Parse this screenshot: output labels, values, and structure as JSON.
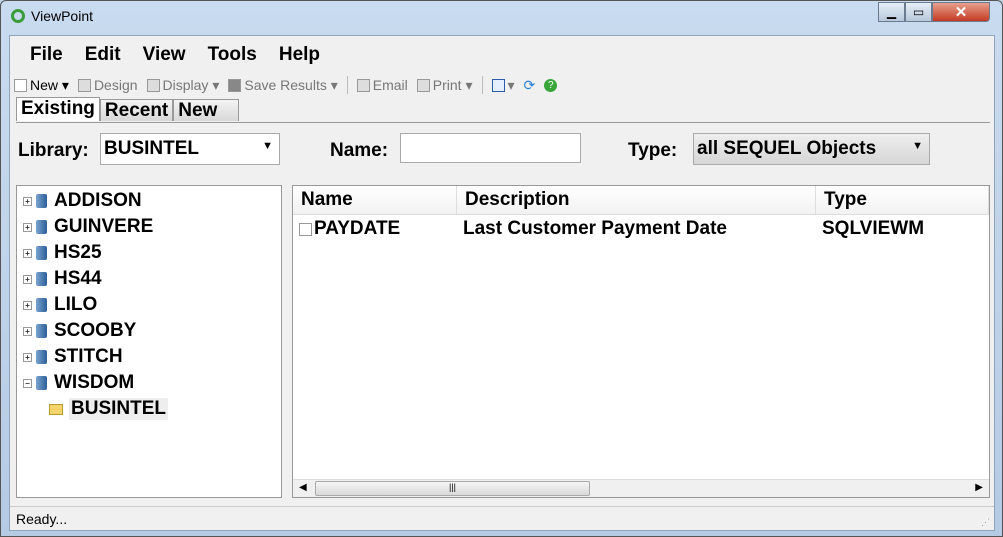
{
  "window": {
    "title": "ViewPoint"
  },
  "menu": [
    "File",
    "Edit",
    "View",
    "Tools",
    "Help"
  ],
  "toolbar": {
    "new": "New",
    "design": "Design",
    "display": "Display",
    "save": "Save Results",
    "email": "Email",
    "print": "Print"
  },
  "tabs": [
    "Existing",
    "Recent",
    "New"
  ],
  "filters": {
    "library_label": "Library:",
    "library_value": "BUSINTEL",
    "name_label": "Name:",
    "name_value": "",
    "type_label": "Type:",
    "type_value": "all SEQUEL Objects"
  },
  "tree": [
    {
      "label": "ADDISON"
    },
    {
      "label": "GUINVERE"
    },
    {
      "label": "HS25"
    },
    {
      "label": "HS44"
    },
    {
      "label": "LILO"
    },
    {
      "label": "SCOOBY"
    },
    {
      "label": "STITCH"
    },
    {
      "label": "WISDOM",
      "child": "BUSINTEL"
    }
  ],
  "grid": {
    "columns": [
      "Name",
      "Description",
      "Type"
    ],
    "rows": [
      {
        "name": "PAYDATE",
        "description": "Last Customer Payment Date",
        "type": "SQLVIEWM"
      }
    ]
  },
  "status": "Ready..."
}
